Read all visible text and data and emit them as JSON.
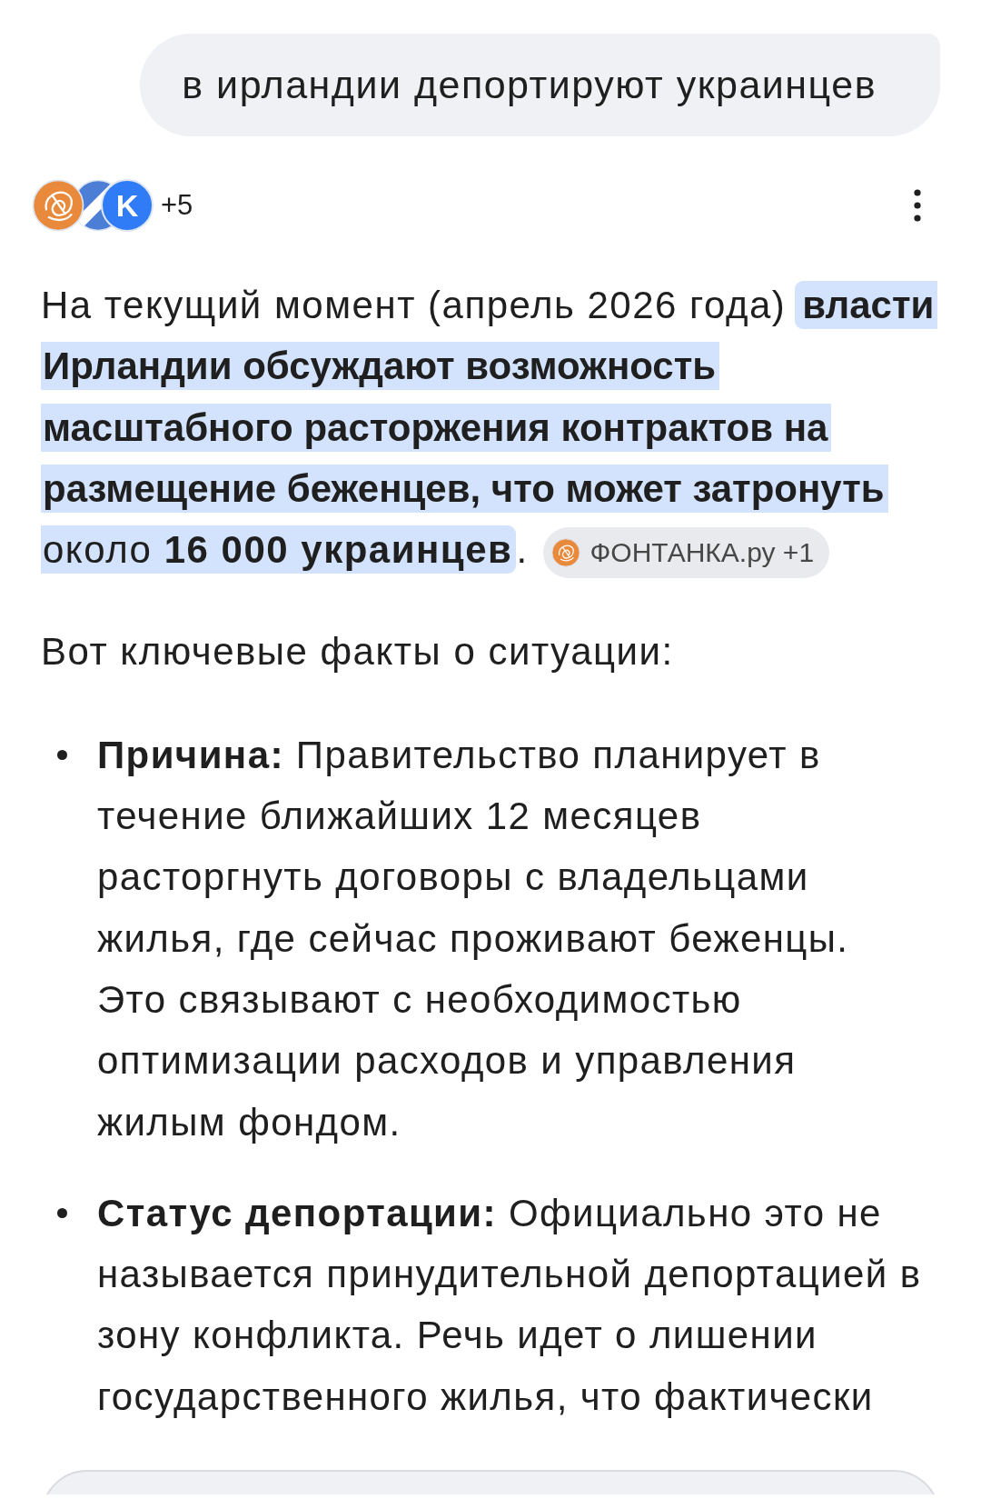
{
  "query": {
    "text": "в ирландии депортируют украинцев"
  },
  "sources": {
    "logos": [
      {
        "kind": "swirl"
      },
      {
        "kind": "band"
      },
      {
        "kind": "letter",
        "letter": "K"
      }
    ],
    "more_count": "+5"
  },
  "answer": {
    "lines": [
      {
        "segments": [
          {
            "text": "На текущий момент (апрель 2026 года)",
            "highlighted": false,
            "bold": false
          },
          {
            "text": "власти",
            "highlighted": true,
            "bold": true
          }
        ]
      },
      {
        "segments": [
          {
            "text": "Ирландии обсуждают возможность",
            "highlighted": true,
            "bold": true
          }
        ]
      },
      {
        "segments": [
          {
            "text": "масштабного расторжения контрактов на",
            "highlighted": true,
            "bold": true
          }
        ]
      },
      {
        "segments": [
          {
            "text": "размещение беженцев, что может затронуть",
            "highlighted": true,
            "bold": true
          }
        ]
      },
      {
        "segments": [
          {
            "text": "около **16 000 украинцев**",
            "highlighted": true,
            "bold": false
          },
          {
            "text": ".",
            "highlighted": false,
            "bold": false
          }
        ]
      }
    ],
    "citation": {
      "label": "ФОНТАНКА.ру +1"
    },
    "lead": "Вот ключевые факты о ситуации:",
    "bullets": [
      {
        "text": "**Причина:** Правительство планирует в течение ближайших 12 месяцев расторгнуть договоры с владельцами жилья, где сейчас проживают беженцы. Это связывают с необходимостью оптимизации расходов и управления жилым фондом."
      },
      {
        "text": "**Статус депортации:** Официально это не называется принудительной депортацией в зону конфликта. Речь идет о лишении государственного жилья, что фактически"
      }
    ]
  }
}
